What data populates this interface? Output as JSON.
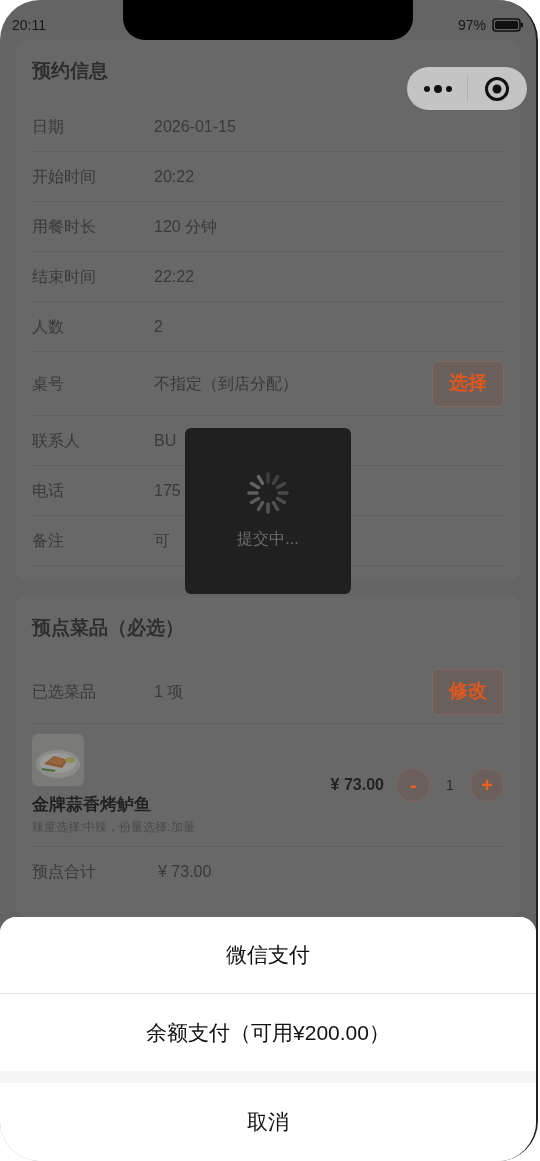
{
  "status_bar": {
    "time": "20:11",
    "battery": "97%"
  },
  "booking": {
    "title": "预约信息",
    "rows": [
      {
        "label": "日期",
        "value": "2026-01-15"
      },
      {
        "label": "开始时间",
        "value": "20:22"
      },
      {
        "label": "用餐时长",
        "value": "120 分钟"
      },
      {
        "label": "结束时间",
        "value": "22:22"
      },
      {
        "label": "人数",
        "value": "2"
      },
      {
        "label": "桌号",
        "value": "不指定（到店分配）",
        "action": "选择"
      },
      {
        "label": "联系人",
        "value": "BU"
      },
      {
        "label": "电话",
        "value": "175"
      },
      {
        "label": "备注",
        "value": "可"
      }
    ]
  },
  "toast": {
    "text": "提交中..."
  },
  "dishes": {
    "title": "预点菜品（必选）",
    "selected_label": "已选菜品",
    "selected_value": "1 项",
    "action": "修改",
    "items": [
      {
        "name": "金牌蒜香烤鲈鱼",
        "options": "辣度选择:中辣，份量选择:加量",
        "price": "¥ 73.00",
        "minus": "-",
        "quantity": "1",
        "plus": "+"
      }
    ],
    "total_label": "预点合计",
    "total_value": "¥ 73.00"
  },
  "sheet": {
    "options": [
      "微信支付",
      "余额支付（可用¥200.00）"
    ],
    "cancel": "取消"
  }
}
